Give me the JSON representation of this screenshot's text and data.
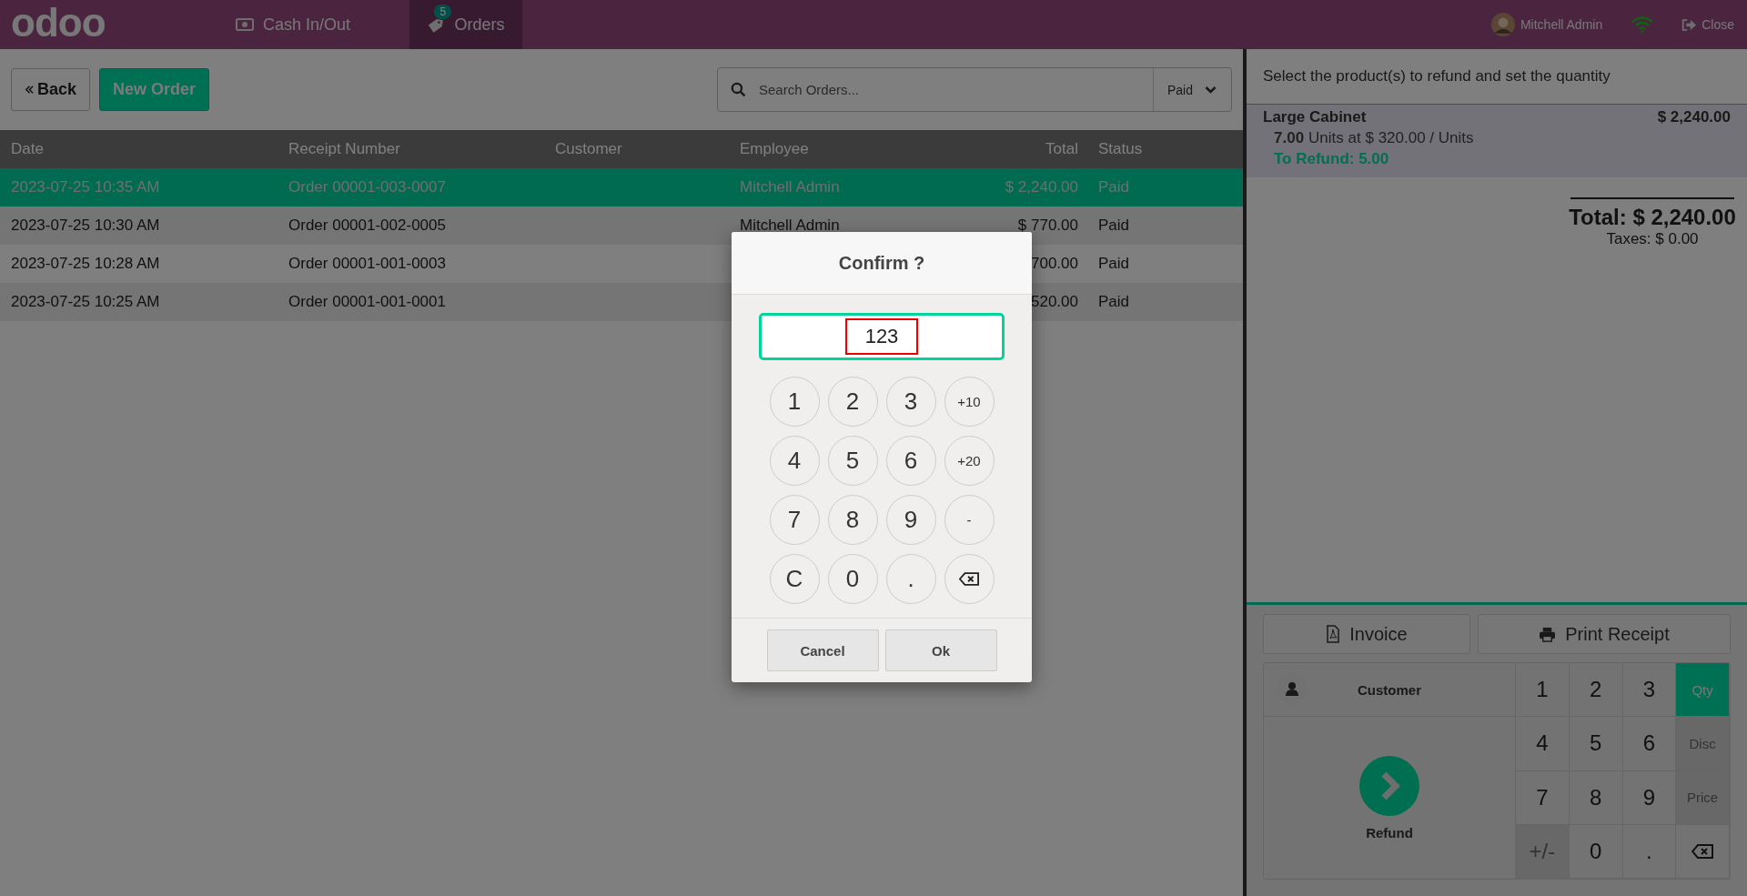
{
  "header": {
    "logo": "odoo",
    "tabs": [
      {
        "label": "Cash In/Out",
        "selected": false
      },
      {
        "label": "Orders",
        "selected": true,
        "badge": "5"
      }
    ],
    "user": "Mitchell Admin",
    "close": "Close"
  },
  "toolbar": {
    "back": "Back",
    "new_order": "New Order",
    "search": {
      "placeholder": "Search Orders..."
    },
    "filter": "Paid"
  },
  "table": {
    "columns": [
      "Date",
      "Receipt Number",
      "Customer",
      "Employee",
      "Total",
      "Status"
    ],
    "rows": [
      {
        "selected": true,
        "date": "2023-07-25 10:35 AM",
        "receipt": "Order 00001-003-0007",
        "employee": "Mitchell Admin",
        "total": "$ 2,240.00",
        "status": "Paid"
      },
      {
        "selected": false,
        "date": "2023-07-25 10:30 AM",
        "receipt": "Order 00001-002-0005",
        "employee": "Mitchell Admin",
        "total": "$ 770.00",
        "status": "Paid"
      },
      {
        "selected": false,
        "date": "2023-07-25 10:28 AM",
        "receipt": "Order 00001-001-0003",
        "total": "700.00",
        "status": "Paid"
      },
      {
        "selected": false,
        "date": "2023-07-25 10:25 AM",
        "receipt": "Order 00001-001-0001",
        "total": "520.00",
        "status": "Paid"
      }
    ]
  },
  "refund_panel": {
    "hint": "Select the product(s) to refund and set the quantity",
    "lines": [
      {
        "product": "Large Cabinet",
        "price": "$ 2,240.00",
        "qty": "7.00",
        "unit_text": "Units at $ 320.00 / Units",
        "to_refund": "To Refund: 5.00"
      }
    ],
    "total": "Total: $ 2,240.00",
    "taxes": "Taxes: $ 0.00",
    "actions": [
      "Invoice",
      "Print Receipt"
    ],
    "customer": "Customer",
    "refund": "Refund",
    "keys": [
      {
        "kind": "digit",
        "label": "1",
        "disabled": false
      },
      {
        "kind": "digit",
        "label": "2",
        "disabled": false
      },
      {
        "kind": "digit",
        "label": "3",
        "disabled": false
      },
      {
        "kind": "mode",
        "label": "Qty",
        "selected": true,
        "disabled": false
      },
      {
        "kind": "digit",
        "label": "4",
        "disabled": false
      },
      {
        "kind": "digit",
        "label": "5",
        "disabled": false
      },
      {
        "kind": "digit",
        "label": "6",
        "disabled": false
      },
      {
        "kind": "mode",
        "label": "Disc",
        "selected": false,
        "disabled": true
      },
      {
        "kind": "digit",
        "label": "7",
        "disabled": false
      },
      {
        "kind": "digit",
        "label": "8",
        "disabled": false
      },
      {
        "kind": "digit",
        "label": "9",
        "disabled": false
      },
      {
        "kind": "mode",
        "label": "Price",
        "selected": false,
        "disabled": true
      },
      {
        "kind": "digit",
        "label": "+/-",
        "disabled": true
      },
      {
        "kind": "digit",
        "label": "0",
        "disabled": false
      },
      {
        "kind": "digit",
        "label": ".",
        "disabled": false
      },
      {
        "kind": "backspace"
      }
    ]
  },
  "dialog": {
    "title": "Confirm ?",
    "value": "123",
    "highlighted": true,
    "keys": [
      {
        "kind": "digit",
        "label": "1"
      },
      {
        "kind": "digit",
        "label": "2"
      },
      {
        "kind": "digit",
        "label": "3"
      },
      {
        "kind": "small",
        "label": "+10"
      },
      {
        "kind": "digit",
        "label": "4"
      },
      {
        "kind": "digit",
        "label": "5"
      },
      {
        "kind": "digit",
        "label": "6"
      },
      {
        "kind": "small",
        "label": "+20"
      },
      {
        "kind": "digit",
        "label": "7"
      },
      {
        "kind": "digit",
        "label": "8"
      },
      {
        "kind": "digit",
        "label": "9"
      },
      {
        "kind": "small",
        "label": "-"
      },
      {
        "kind": "digit",
        "label": "C"
      },
      {
        "kind": "digit",
        "label": "0"
      },
      {
        "kind": "digit",
        "label": "."
      },
      {
        "kind": "backspace"
      }
    ],
    "buttons": [
      "Cancel",
      "Ok"
    ]
  }
}
